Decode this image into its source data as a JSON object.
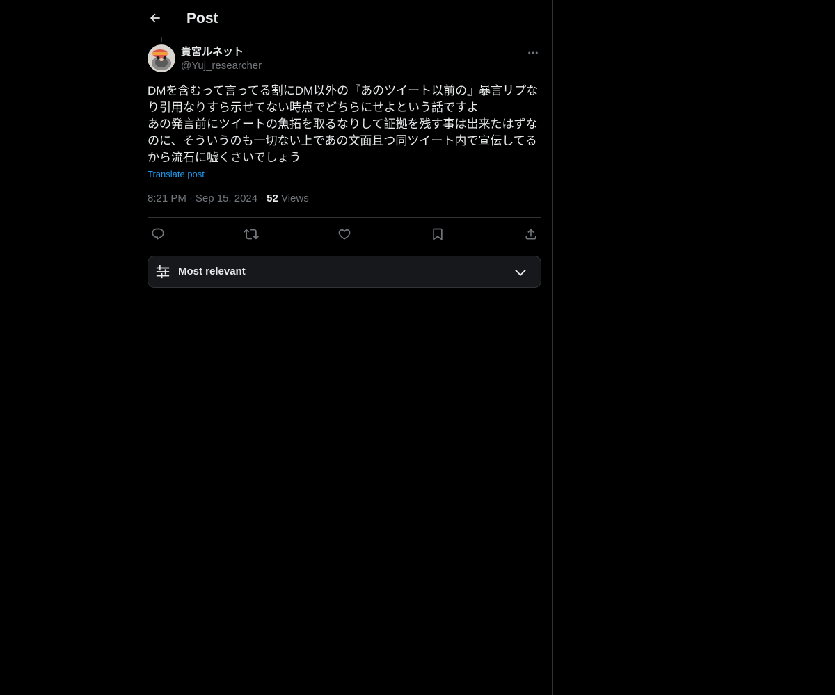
{
  "header": {
    "title": "Post",
    "back_icon": "arrow-left-icon"
  },
  "tweet": {
    "author": {
      "display_name": "貴宮ルネット",
      "handle": "@Yuj_researcher",
      "avatar_icon": "avatar-image"
    },
    "more_icon": "more-horizontal-icon",
    "text": "DMを含むって言ってる割にDM以外の『あのツイート以前の』暴言リプなり引用なりすら示せてない時点でどちらにせよという話ですよ\nあの発言前にツイートの魚拓を取るなりして証拠を残す事は出来たはずなのに、そういうのも一切ない上であの文面且つ同ツイート内で宣伝してるから流石に嘘くさいでしょう",
    "translate_label": "Translate post",
    "time": "8:21 PM",
    "date": "Sep 15, 2024",
    "views_count": "52",
    "views_label": "Views",
    "separator": "·"
  },
  "actions": [
    {
      "name": "reply",
      "icon": "reply-icon"
    },
    {
      "name": "repost",
      "icon": "repost-icon"
    },
    {
      "name": "like",
      "icon": "heart-icon"
    },
    {
      "name": "bookmark",
      "icon": "bookmark-icon"
    },
    {
      "name": "share",
      "icon": "share-icon"
    }
  ],
  "sort": {
    "label": "Most relevant",
    "icon": "sliders-icon",
    "chevron": "chevron-down-icon"
  },
  "colors": {
    "background": "#000000",
    "text": "#e7e9ea",
    "secondary": "#71767b",
    "link": "#1d9bf0",
    "border": "#2f3336"
  }
}
